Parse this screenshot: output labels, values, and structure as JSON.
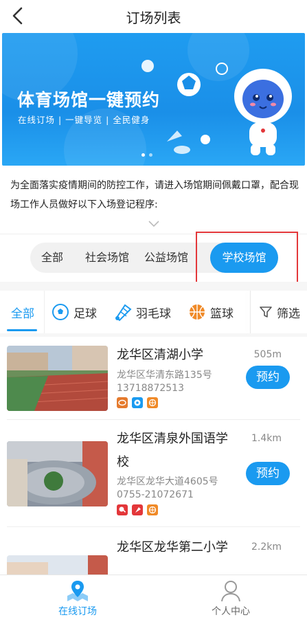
{
  "header": {
    "title": "订场列表"
  },
  "banner": {
    "title": "体育场馆一键预约",
    "subtitle": "在线订场 | 一键导览 | 全民健身"
  },
  "notice": {
    "text": "为全面落实疫情期间的防控工作，请进入场馆期间佩戴口罩，配合现场工作人员做好以下入场登记程序:"
  },
  "segments": [
    "全部",
    "社会场馆",
    "公益场馆",
    "学校场馆"
  ],
  "active_segment": "学校场馆",
  "tabs": [
    "全部",
    "足球",
    "羽毛球",
    "篮球"
  ],
  "active_tab": "全部",
  "filter_label": "筛选",
  "venues": [
    {
      "name": "龙华区清湖小学",
      "address": "龙华区华清东路135号",
      "phone": "13718872513",
      "distance": "505m",
      "book": "预约"
    },
    {
      "name": "龙华区清泉外国语学校",
      "address": "龙华区龙华大道4605号",
      "phone": "0755-21072671",
      "distance": "1.4km",
      "book": "预约"
    },
    {
      "name": "龙华区龙华第二小学",
      "distance": "2.2km"
    }
  ],
  "bottom_nav": [
    {
      "label": "在线订场",
      "active": true
    },
    {
      "label": "个人中心",
      "active": false
    }
  ],
  "colors": {
    "accent": "#1a9af0",
    "highlight_box": "#e3373a"
  }
}
